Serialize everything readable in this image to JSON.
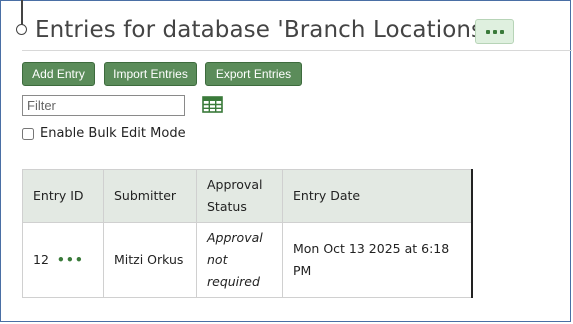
{
  "title": "Entries for database 'Branch Locations'",
  "title_more": "•••",
  "buttons": {
    "add_entry": "Add Entry",
    "import_entries": "Import Entries",
    "export_entries": "Export Entries"
  },
  "filter": {
    "placeholder": "Filter",
    "value": ""
  },
  "bulk_edit_label": "Enable Bulk Edit Mode",
  "table": {
    "headers": [
      "Entry ID",
      "Submitter",
      "Approval Status",
      "Entry Date"
    ],
    "rows": [
      {
        "entry_id": "12",
        "row_menu": "•••",
        "submitter": "Mitzi Orkus",
        "approval_status": "Approval not required",
        "entry_date": "Mon Oct 13 2025 at 6:18 PM"
      }
    ]
  },
  "colors": {
    "button_green": "#5b8c5a",
    "header_bg": "#e3e9e3",
    "accent_dots": "#3a7a3a"
  }
}
